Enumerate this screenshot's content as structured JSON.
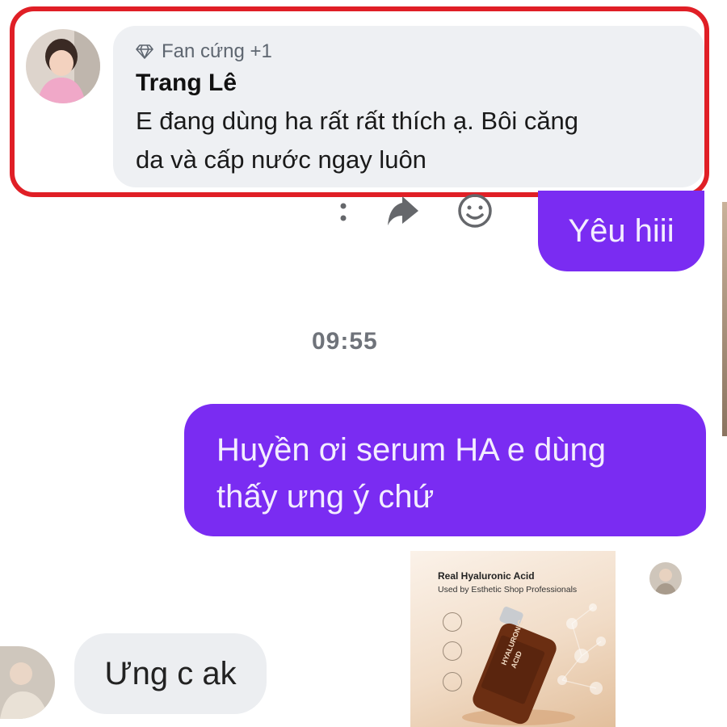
{
  "comment": {
    "badge": "Fan cứng +1",
    "author": "Trang Lê",
    "text_line1": "E đang dùng ha rất rất thích ạ. Bôi căng",
    "text_line2": "da và cấp nước ngay luôn"
  },
  "messages": {
    "outgoing_1": "Yêu hiii",
    "timestamp": "09:55",
    "outgoing_2_line1": "Huyền ơi serum HA e dùng",
    "outgoing_2_line2": "thấy ưng ý chứ",
    "incoming_1": "Ưng c ak"
  },
  "product_image": {
    "title": "Real Hyaluronic Acid",
    "subtitle": "Used by Esthetic Shop Professionals",
    "bottle_label_line1": "HYALURONIC",
    "bottle_label_line2": "ACID"
  },
  "colors": {
    "highlight_border": "#e01f26",
    "outgoing_bubble": "#7a2cf2",
    "incoming_bubble": "#eceef1",
    "comment_bubble": "#eef0f3"
  },
  "icons": [
    "diamond-icon",
    "more-vertical-icon",
    "share-icon",
    "emoji-icon"
  ]
}
